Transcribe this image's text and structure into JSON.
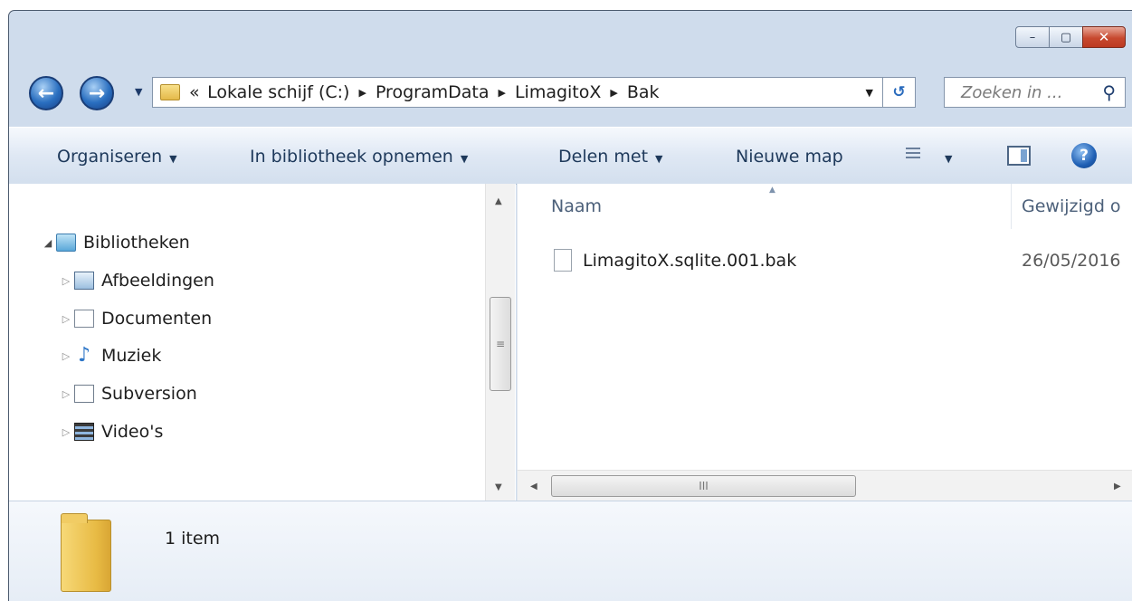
{
  "window": {
    "caption_buttons": {
      "minimize": "–",
      "maximize": "▢",
      "close": "✕"
    }
  },
  "nav": {
    "back_glyph": "←",
    "forward_glyph": "→",
    "breadcrumb_overflow": "«",
    "breadcrumbs": [
      "Lokale schijf (C:)",
      "ProgramData",
      "LimagitoX",
      "Bak"
    ],
    "separator": "▶",
    "refresh_glyph": "↺",
    "search_placeholder": "Zoeken in ...",
    "search_icon": "⚲"
  },
  "toolbar": {
    "organize": "Organiseren",
    "include_library": "In bibliotheek opnemen",
    "share": "Delen met",
    "new_folder": "Nieuwe map",
    "caret": "▼",
    "help": "?"
  },
  "sidebar": {
    "root": {
      "label": "Bibliotheken",
      "icon": "library-icon",
      "expanded": true
    },
    "items": [
      {
        "label": "Afbeeldingen",
        "icon": "pictures-icon"
      },
      {
        "label": "Documenten",
        "icon": "documents-icon"
      },
      {
        "label": "Muziek",
        "icon": "music-icon"
      },
      {
        "label": "Subversion",
        "icon": "subversion-icon"
      },
      {
        "label": "Video's",
        "icon": "videos-icon"
      }
    ]
  },
  "content": {
    "columns": [
      "Naam",
      "Gewijzigd o"
    ],
    "files": [
      {
        "name": "LimagitoX.sqlite.001.bak",
        "modified": "26/05/2016"
      }
    ],
    "scroll_grip": "III"
  },
  "details": {
    "count": "1 item"
  },
  "colors": {
    "window_frame": "#cfdcec",
    "toolbar_text": "#1e395b",
    "close_button": "#c7492f"
  }
}
